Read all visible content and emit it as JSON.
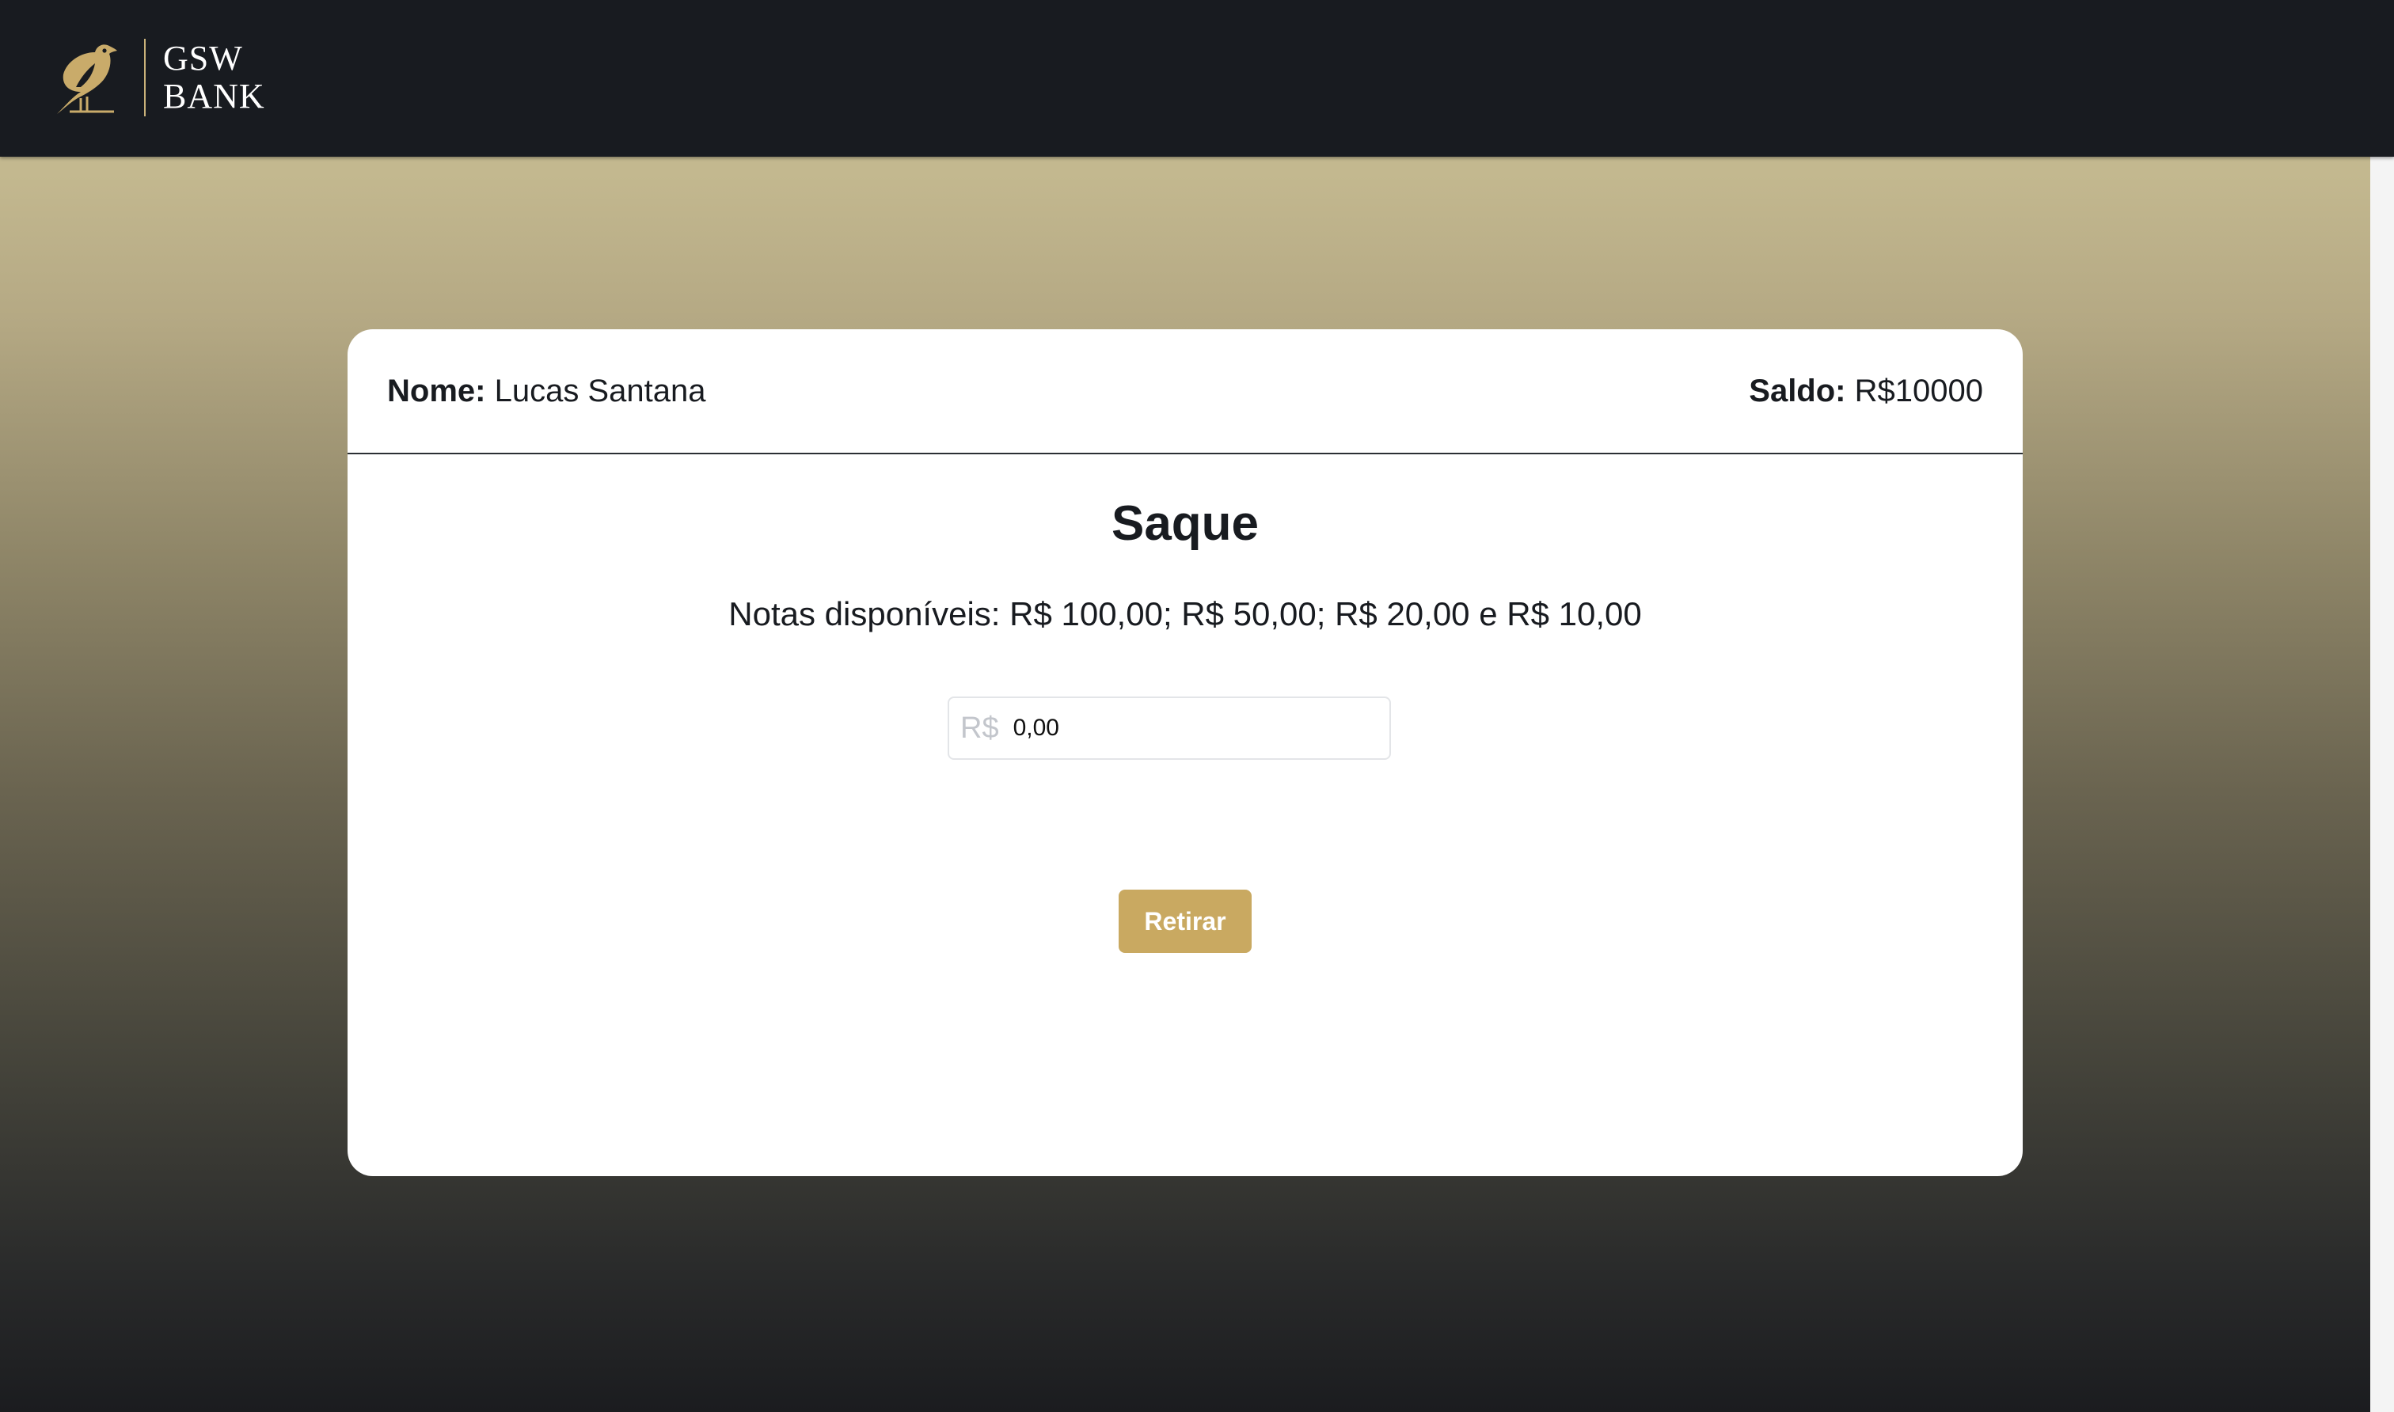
{
  "brand": {
    "name_line1": "GSW",
    "name_line2": "BANK",
    "logo_icon": "bird-icon",
    "accent_color": "#c9a961"
  },
  "account": {
    "name_label": "Nome:",
    "name_value": "Lucas Santana",
    "balance_label": "Saldo:",
    "balance_value": "R$10000"
  },
  "withdraw": {
    "title": "Saque",
    "notes_text": "Notas disponíveis: R$ 100,00; R$ 50,00; R$ 20,00 e R$ 10,00",
    "currency_prefix": "R$",
    "amount_value": "0,00",
    "button_label": "Retirar"
  }
}
